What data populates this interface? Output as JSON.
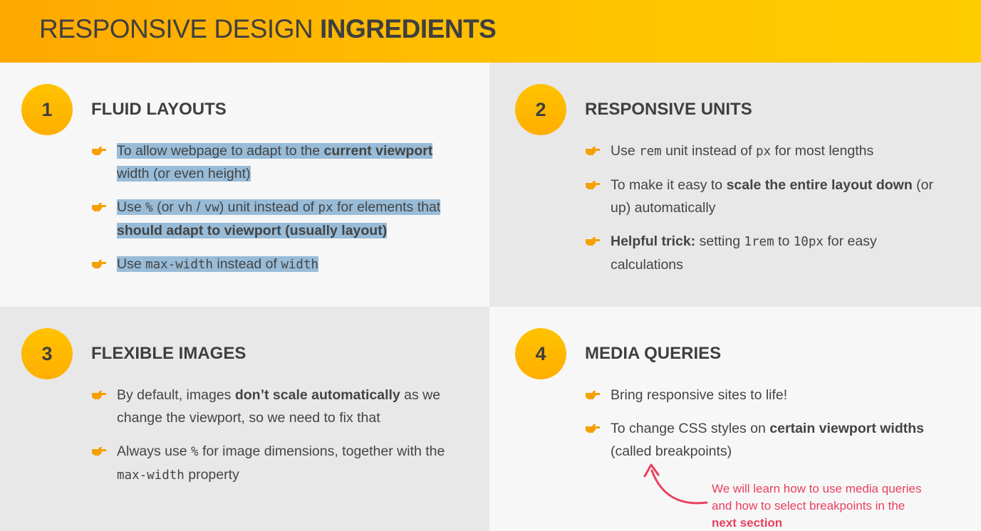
{
  "header": {
    "title_light": "RESPONSIVE DESIGN ",
    "title_bold": "INGREDIENTS"
  },
  "sections": [
    {
      "number": "1",
      "title": "FLUID LAYOUTS",
      "items": [
        {
          "parts": [
            "To allow webpage to adapt to the ",
            "current viewport",
            " width (or even height)"
          ]
        },
        {
          "parts": [
            "Use ",
            "%",
            " (or ",
            "vh",
            " / ",
            "vw",
            ") unit instead of ",
            "px",
            " for elements that ",
            "should adapt to viewport (usually layout)"
          ]
        },
        {
          "parts": [
            "Use ",
            "max-width",
            " instead of ",
            "width"
          ]
        }
      ]
    },
    {
      "number": "2",
      "title": "RESPONSIVE UNITS",
      "items": [
        {
          "parts": [
            "Use ",
            "rem",
            " unit instead of ",
            "px",
            " for most lengths"
          ]
        },
        {
          "parts": [
            "To make it easy to ",
            "scale the entire layout down",
            " (or up) automatically"
          ]
        },
        {
          "parts": [
            "Helpful trick:",
            " setting ",
            "1rem",
            " to ",
            "10px",
            " for easy calculations"
          ]
        }
      ]
    },
    {
      "number": "3",
      "title": "FLEXIBLE IMAGES",
      "items": [
        {
          "parts": [
            "By default, images ",
            "don’t scale automatically",
            " as we change the viewport, so we need to fix that"
          ]
        },
        {
          "parts": [
            "Always use ",
            "%",
            " for image dimensions, together with the ",
            "max-width",
            " property"
          ]
        }
      ]
    },
    {
      "number": "4",
      "title": "MEDIA QUERIES",
      "items": [
        {
          "parts": [
            "Bring responsive sites to life!"
          ]
        },
        {
          "parts": [
            "To change CSS styles on ",
            "certain viewport widths",
            " (called breakpoints)"
          ]
        }
      ],
      "note": {
        "text": "We will learn how to use media queries and how to select breakpoints in the ",
        "bold": "next section"
      }
    }
  ],
  "icons": {
    "bullet": "pointing-hand-icon",
    "note_arrow": "curved-arrow-icon"
  },
  "colors": {
    "accent": "#ffb800",
    "note": "#e8405e",
    "highlight": "#98bcd8"
  }
}
